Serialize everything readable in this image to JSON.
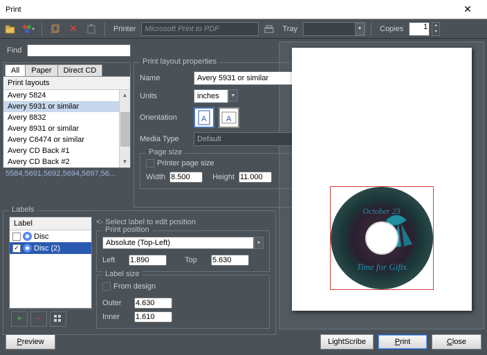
{
  "window": {
    "title": "Print"
  },
  "toolbar": {
    "printer_label": "Printer",
    "printer_value": "Microsoft Print to PDF",
    "tray_label": "Tray",
    "tray_value": "",
    "copies_label": "Copies",
    "copies_value": "1"
  },
  "find": {
    "label": "Find",
    "value": ""
  },
  "layout_tabs": {
    "all": "All",
    "paper": "Paper",
    "direct": "Direct CD"
  },
  "layout_list": {
    "header": "Print layouts",
    "items": [
      "Avery 5824",
      "Avery 5931 or similar",
      "Avery 8832",
      "Avery 8931 or similar",
      "Avery C6474 or similar",
      "Avery CD Back #1",
      "Avery CD Back #2"
    ],
    "selected_index": 1,
    "footer": "5584,5691,5692,5694,5697,56..."
  },
  "props": {
    "group": "Print layout properties",
    "name_label": "Name",
    "name_value": "Avery 5931 or similar",
    "units_label": "Units",
    "units_value": "inches",
    "orientation_label": "Orientation",
    "media_label": "Media Type",
    "media_value": "Default",
    "pagesize_group": "Page size",
    "printer_page_size": "Printer page size",
    "width_label": "Width",
    "width_value": "8.500",
    "height_label": "Height",
    "height_value": "11.000"
  },
  "labels": {
    "group": "Labels",
    "header": "Label",
    "items": [
      {
        "checked": false,
        "name": "Disc"
      },
      {
        "checked": true,
        "name": "Disc (2)"
      }
    ],
    "selected_index": 1
  },
  "position": {
    "hint": "<- Select label to edit position",
    "group": "Print position",
    "mode": "Absolute (Top-Left)",
    "left_label": "Left",
    "left_value": "1.890",
    "top_label": "Top",
    "top_value": "5.630"
  },
  "size": {
    "group": "Label size",
    "from_design": "From design",
    "outer_label": "Outer",
    "outer_value": "4.630",
    "inner_label": "Inner",
    "inner_value": "1.610"
  },
  "disc_art": {
    "text1": "October 23",
    "text2": "Time for Gifts"
  },
  "buttons": {
    "preview": "Preview",
    "lightscribe": "LightScribe",
    "print": "Print",
    "close": "Close"
  }
}
